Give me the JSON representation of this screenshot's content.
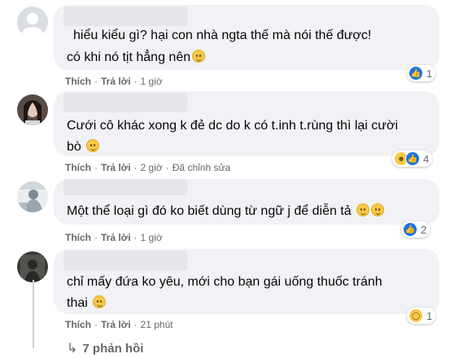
{
  "comments": [
    {
      "lines": [
        "hiểu kiểu gì? hại con nhà ngta thế mà nói thế được!",
        "có khi nó tịt hẳng nên"
      ],
      "actions": {
        "like": "Thích",
        "reply": "Trả lời",
        "time": "1 giờ",
        "extra": ""
      },
      "reactions": {
        "types": [
          "like-icon"
        ],
        "count": "1"
      }
    },
    {
      "lines": [
        "Cưới cô khác xong k đẻ dc do k có t.inh t.rùng thì lại cười",
        "bò"
      ],
      "actions": {
        "like": "Thích",
        "reply": "Trả lời",
        "time": "2 giờ",
        "extra": "Đã chỉnh sửa"
      },
      "reactions": {
        "types": [
          "haha-icon",
          "like-icon"
        ],
        "count": "4"
      }
    },
    {
      "lines": [
        "Một thể loại gì đó ko biết dùng từ ngữ j để diễn tả"
      ],
      "actions": {
        "like": "Thích",
        "reply": "Trả lời",
        "time": "1 giờ",
        "extra": ""
      },
      "reactions": {
        "types": [
          "like-icon"
        ],
        "count": "2"
      }
    },
    {
      "lines": [
        "chỉ mấy đứa ko yêu, mới cho bạn gái uống thuốc tránh",
        "thai"
      ],
      "actions": {
        "like": "Thích",
        "reply": "Trả lời",
        "time": "21 phút",
        "extra": ""
      },
      "reactions": {
        "types": [
          "wow-icon"
        ],
        "count": "1"
      }
    }
  ],
  "replies_link": "7 phản hồi",
  "colors": {
    "like": "#1b74e4",
    "bubble": "#f0f2f5",
    "meta": "#65676b"
  }
}
